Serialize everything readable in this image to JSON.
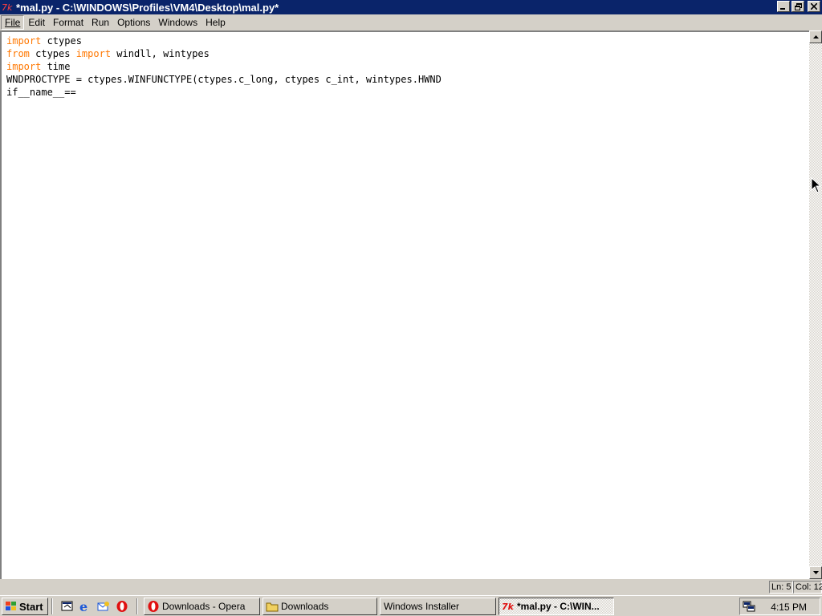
{
  "window": {
    "title": "*mal.py - C:\\WINDOWS\\Profiles\\VM4\\Desktop\\mal.py*",
    "icon": "idle-python-icon",
    "controls": {
      "minimize": "_",
      "restore": "❐",
      "close": "✕"
    }
  },
  "menubar": {
    "items": [
      {
        "label": "File",
        "underline": "F"
      },
      {
        "label": "Edit",
        "underline": "E"
      },
      {
        "label": "Format",
        "underline": "o"
      },
      {
        "label": "Run",
        "underline": "R"
      },
      {
        "label": "Options",
        "underline": "O"
      },
      {
        "label": "Windows",
        "underline": "W"
      },
      {
        "label": "Help",
        "underline": "H"
      }
    ]
  },
  "editor": {
    "lines": [
      [
        {
          "text": "import",
          "kw": true
        },
        {
          "text": " ctypes",
          "kw": false
        }
      ],
      [
        {
          "text": "from",
          "kw": true
        },
        {
          "text": " ctypes ",
          "kw": false
        },
        {
          "text": "import",
          "kw": true
        },
        {
          "text": " windll, wintypes",
          "kw": false
        }
      ],
      [
        {
          "text": "import",
          "kw": true
        },
        {
          "text": " time",
          "kw": false
        }
      ],
      [
        {
          "text": "WNDPROCTYPE = ctypes.WINFUNCTYPE(ctypes.c_long, ctypes c_int, wintypes.HWND",
          "kw": false
        }
      ],
      [
        {
          "text": "if__name__==",
          "kw": false
        }
      ]
    ],
    "keyword_color": "#ff7700"
  },
  "statusbar": {
    "line": "Ln: 5",
    "col": "Col: 12"
  },
  "taskbar": {
    "start_label": "Start",
    "quicklaunch": [
      "show-desktop-icon",
      "internet-explorer-icon",
      "outlook-express-icon",
      "opera-icon"
    ],
    "tasks": [
      {
        "label": "Downloads - Opera",
        "icon": "opera-icon",
        "active": false
      },
      {
        "label": "Downloads",
        "icon": "folder-icon",
        "active": false
      },
      {
        "label": "Windows Installer",
        "icon": "",
        "active": false
      },
      {
        "label": "*mal.py - C:\\WIN...",
        "icon": "idle-python-icon",
        "active": true
      }
    ],
    "clock": "4:15 PM"
  },
  "colors": {
    "titlebar": "#0a246a",
    "face": "#d4d0c8"
  }
}
